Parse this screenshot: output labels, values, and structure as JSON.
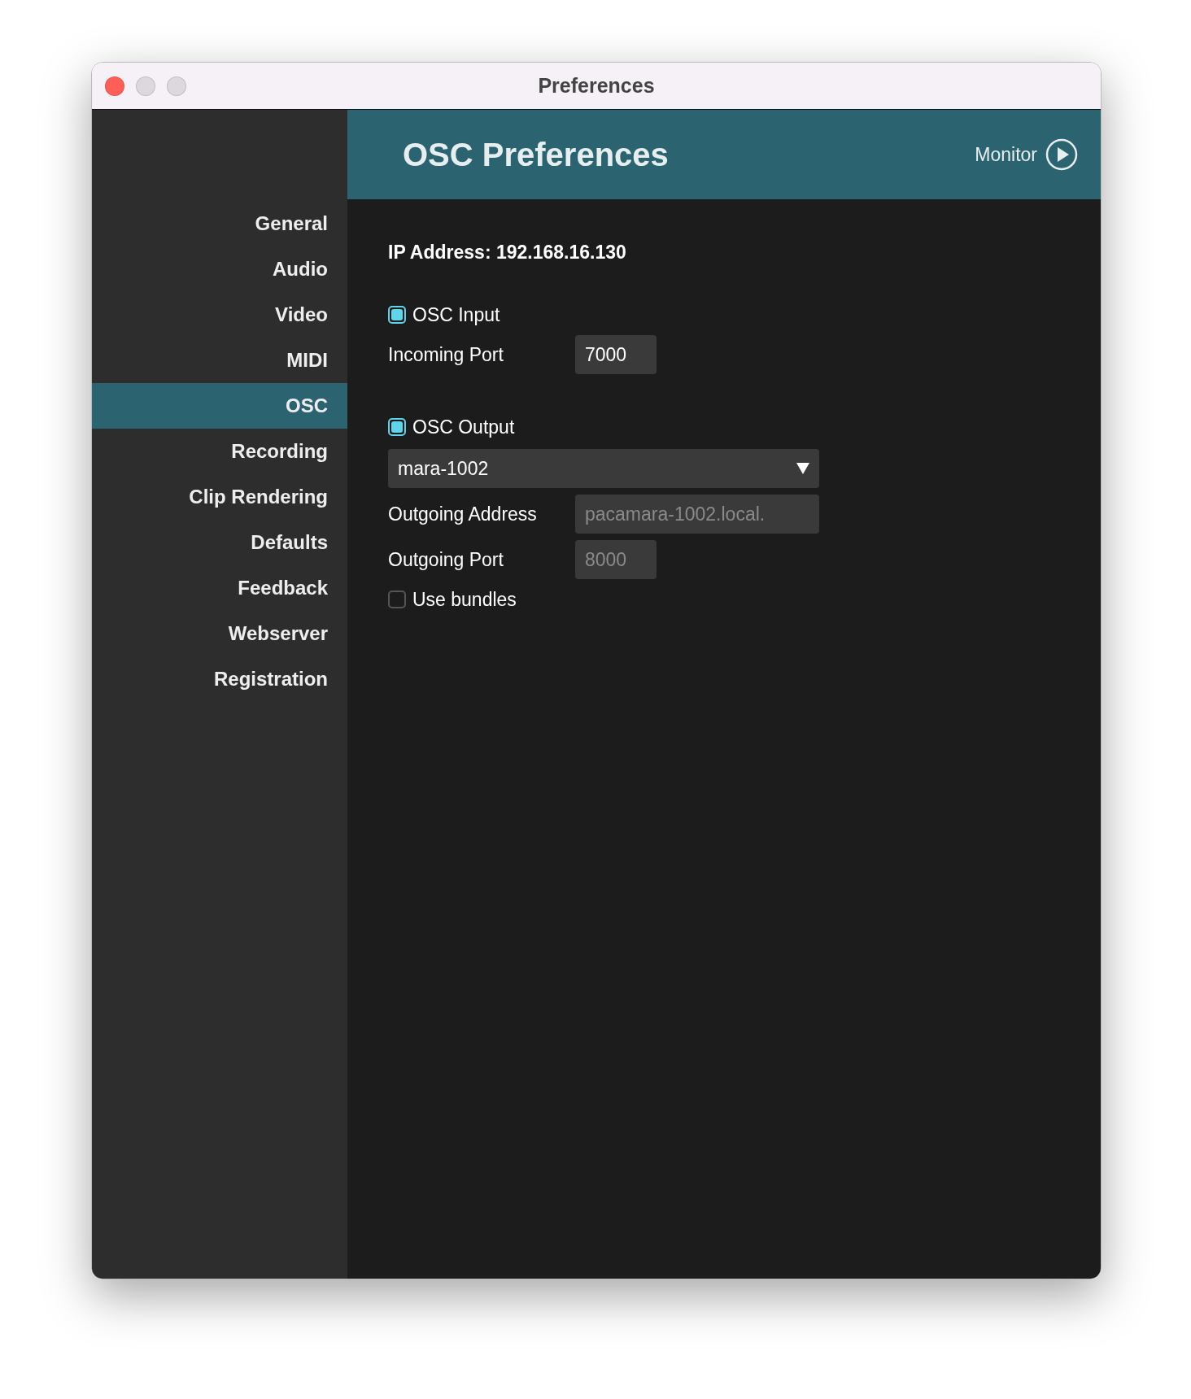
{
  "window": {
    "title": "Preferences"
  },
  "sidebar": {
    "items": [
      {
        "label": "General",
        "selected": false
      },
      {
        "label": "Audio",
        "selected": false
      },
      {
        "label": "Video",
        "selected": false
      },
      {
        "label": "MIDI",
        "selected": false
      },
      {
        "label": "OSC",
        "selected": true
      },
      {
        "label": "Recording",
        "selected": false
      },
      {
        "label": "Clip Rendering",
        "selected": false
      },
      {
        "label": "Defaults",
        "selected": false
      },
      {
        "label": "Feedback",
        "selected": false
      },
      {
        "label": "Webserver",
        "selected": false
      },
      {
        "label": "Registration",
        "selected": false
      }
    ]
  },
  "header": {
    "title": "OSC Preferences",
    "monitor_label": "Monitor"
  },
  "ip_address": "IP Address: 192.168.16.130",
  "osc_input": {
    "label": "OSC Input",
    "checked": true,
    "port_label": "Incoming Port",
    "port_value": "7000"
  },
  "osc_output": {
    "label": "OSC Output",
    "checked": true,
    "target": "mara-1002",
    "address_label": "Outgoing Address",
    "address_placeholder": "pacamara-1002.local.",
    "port_label": "Outgoing Port",
    "port_placeholder": "8000"
  },
  "use_bundles": {
    "label": "Use bundles",
    "checked": false
  }
}
